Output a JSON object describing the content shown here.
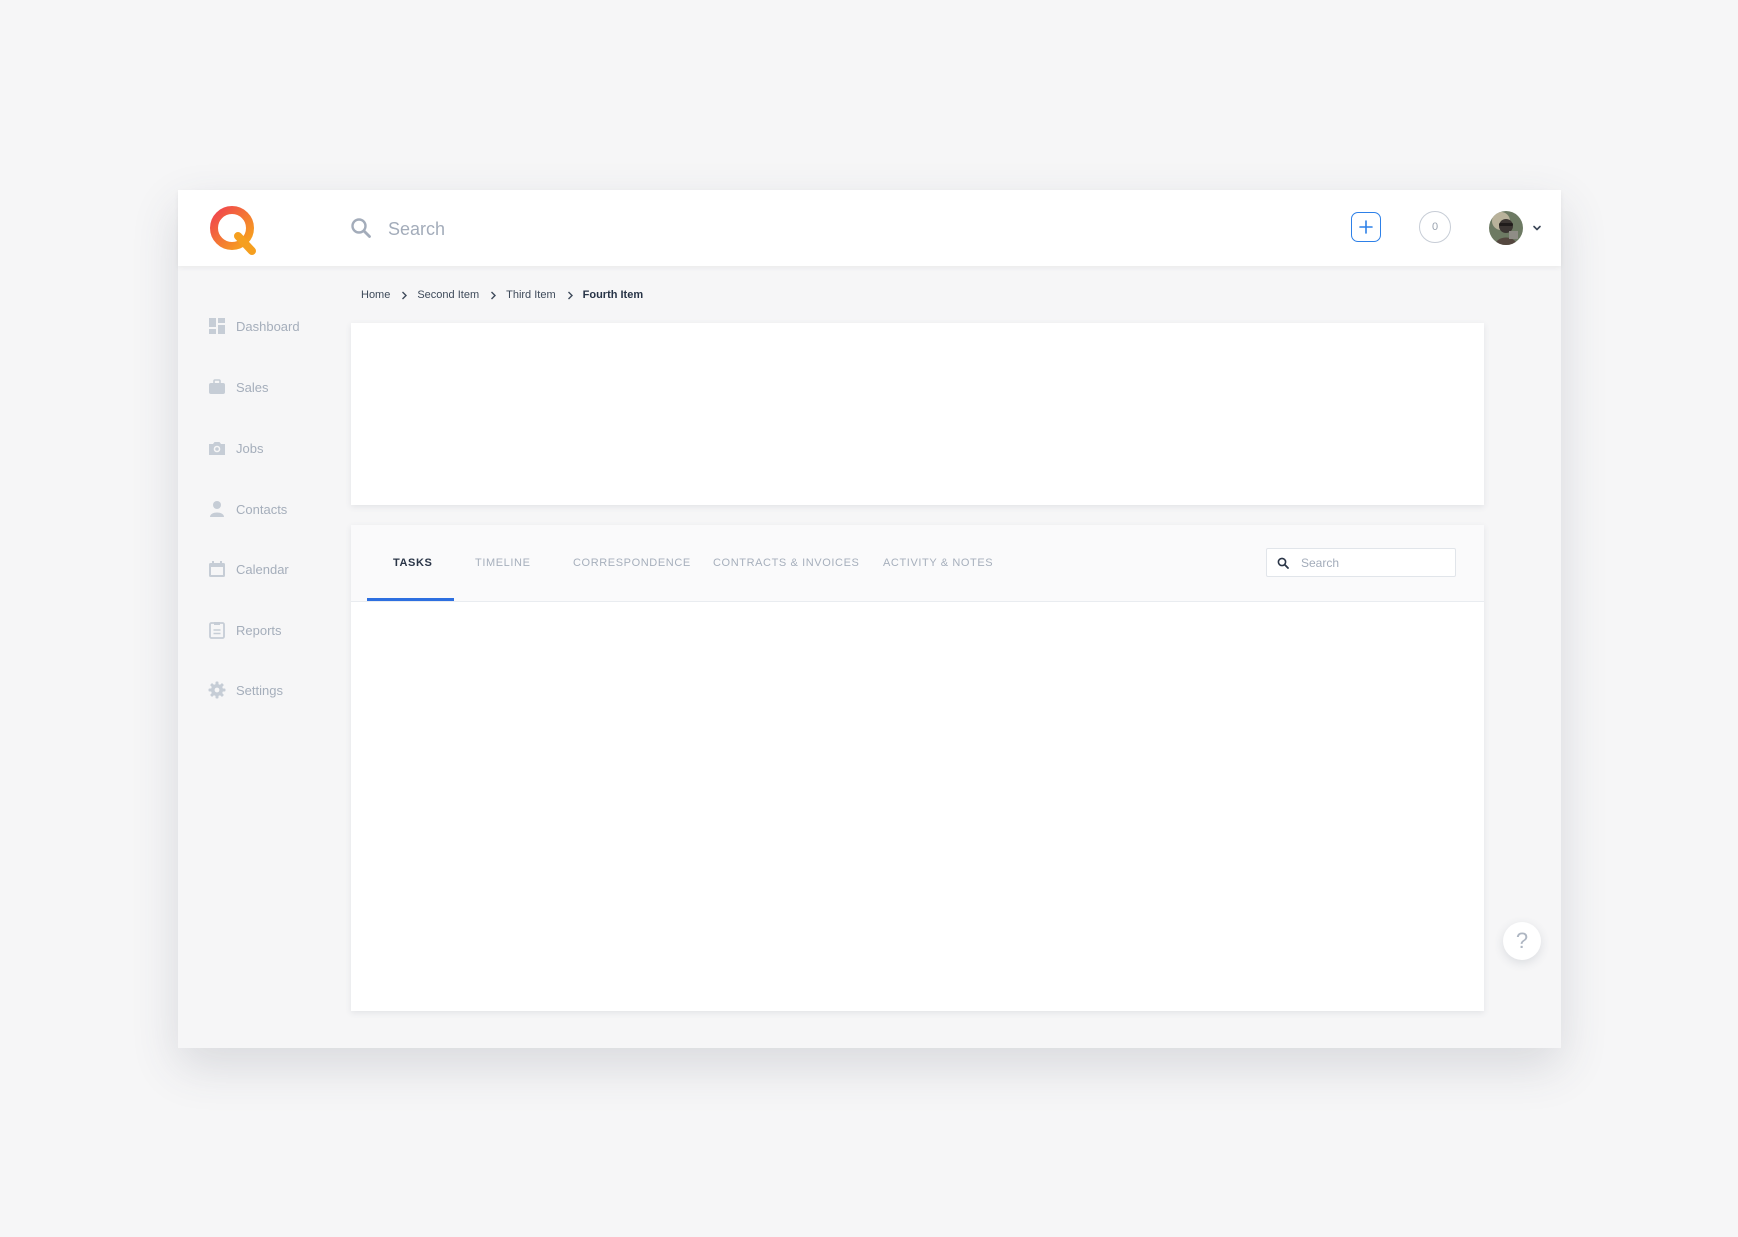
{
  "header": {
    "search_placeholder": "Search",
    "notification_count": "0"
  },
  "sidebar": {
    "items": [
      {
        "label": "Dashboard",
        "icon": "dashboard-icon"
      },
      {
        "label": "Sales",
        "icon": "briefcase-icon"
      },
      {
        "label": "Jobs",
        "icon": "camera-icon"
      },
      {
        "label": "Contacts",
        "icon": "person-icon"
      },
      {
        "label": "Calendar",
        "icon": "calendar-icon"
      },
      {
        "label": "Reports",
        "icon": "clipboard-icon"
      },
      {
        "label": "Settings",
        "icon": "gear-icon"
      }
    ]
  },
  "breadcrumb": {
    "items": [
      "Home",
      "Second Item",
      "Third Item",
      "Fourth Item"
    ]
  },
  "tabs": {
    "items": [
      {
        "label": "TASKS",
        "active": true
      },
      {
        "label": "TIMELINE",
        "active": false
      },
      {
        "label": "CORRESPONDENCE",
        "active": false
      },
      {
        "label": "CONTRACTS & INVOICES",
        "active": false
      },
      {
        "label": "ACTIVITY & NOTES",
        "active": false
      }
    ],
    "search_placeholder": "Search"
  },
  "help": {
    "label": "?"
  },
  "colors": {
    "accent": "#2d6fe0",
    "logo_start": "#f04a4a",
    "logo_end": "#f7a21b",
    "nav_text": "#a5aebb",
    "page_bg": "#f6f6f7"
  }
}
